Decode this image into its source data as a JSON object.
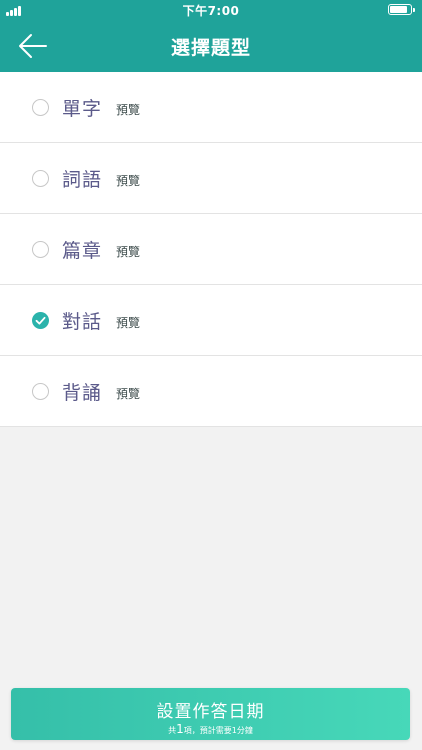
{
  "status_bar": {
    "time": "下午7:00",
    "battery_level": 0.85
  },
  "nav": {
    "title": "選擇題型",
    "back_icon": "arrow-left-icon"
  },
  "question_types": [
    {
      "label": "單字",
      "preview": "預覽",
      "checked": false
    },
    {
      "label": "詞語",
      "preview": "預覽",
      "checked": false
    },
    {
      "label": "篇章",
      "preview": "預覽",
      "checked": false
    },
    {
      "label": "對話",
      "preview": "預覽",
      "checked": true
    },
    {
      "label": "背誦",
      "preview": "預覽",
      "checked": false
    }
  ],
  "bottom_button": {
    "title": "設置作答日期",
    "summary_prefix": "共",
    "count": "1",
    "summary_suffix": "項，預計需要1分鐘"
  },
  "colors": {
    "primary": "#1fa39a",
    "check": "#2bb3ab",
    "label": "#5b5a8a",
    "button_start": "#35bfa9",
    "button_end": "#47d8b9"
  }
}
